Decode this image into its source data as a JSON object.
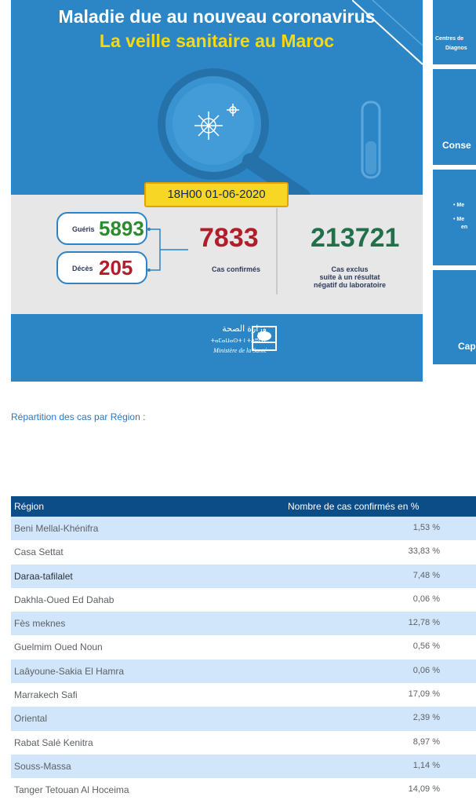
{
  "banner": {
    "title_line1": "Maladie due au nouveau coronavirus",
    "title_line2": "La veille sanitaire au Maroc",
    "datetime": "18H00 01-06-2020",
    "gueris_label": "Guéris",
    "gueris_value": "5893",
    "deces_label": "Décès",
    "deces_value": "205",
    "confirmed_value": "7833",
    "confirmed_label": "Cas confirmés",
    "excluded_value": "213721",
    "excluded_label_1": "Cas exclus",
    "excluded_label_2": "suite à un résultat",
    "excluded_label_3": "négatif du laboratoire",
    "ministry_ar": "وزارة الصحة",
    "ministry_tf": "ⵜⴰⵎⴰⵡⴰⵙⵜ ⵏ ⵜⴷⵓⵙⵉ",
    "ministry_fr": "Ministère de la Santé",
    "colors": {
      "blue": "#2c86c6",
      "yellow": "#f5d90f",
      "red": "#b01e2a",
      "green": "#2c8b2c"
    }
  },
  "side_cards": [
    {
      "line1": "Centres de",
      "line2": "Diagnos"
    },
    {
      "label": "Conse"
    },
    {
      "bullet1": "• Me",
      "bullet2": "• Me",
      "bullet3": "en"
    },
    {
      "label": "Cap"
    }
  ],
  "section_title": "Répartition des cas par Région :",
  "table": {
    "headers": [
      "Région",
      "Nombre de cas confirmés en %"
    ],
    "rows": [
      {
        "region": "Beni Mellal-Khénifra",
        "pct": "1,53 %"
      },
      {
        "region": "Casa Settat",
        "pct": "33,83 %"
      },
      {
        "region": "Daraa-tafilalet",
        "pct": "7,48 %"
      },
      {
        "region": "Dakhla-Oued Ed Dahab",
        "pct": "0,06 %"
      },
      {
        "region": "Fès meknes",
        "pct": "12,78 %"
      },
      {
        "region": "Guelmim Oued Noun",
        "pct": "0,56 %"
      },
      {
        "region": "Laâyoune-Sakia El Hamra",
        "pct": "0,06 %"
      },
      {
        "region": "Marrakech Safi",
        "pct": "17,09 %"
      },
      {
        "region": "Oriental",
        "pct": "2,39 %"
      },
      {
        "region": "Rabat Salé Kenitra",
        "pct": "8,97 %"
      },
      {
        "region": "Souss-Massa",
        "pct": "1,14 %"
      },
      {
        "region": "Tanger Tetouan Al Hoceima",
        "pct": "14,09 %"
      }
    ]
  }
}
